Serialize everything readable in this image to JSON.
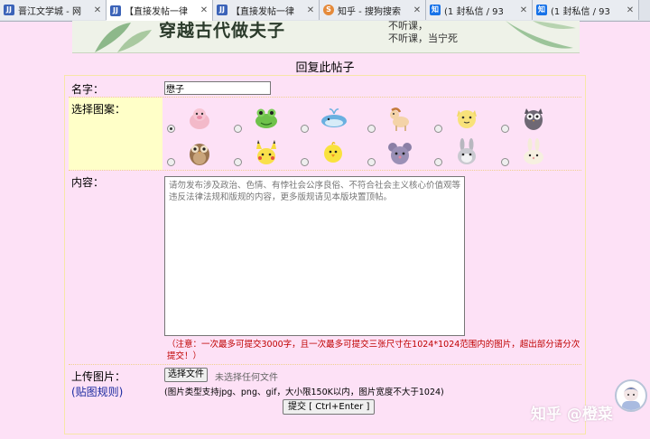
{
  "tabs": [
    {
      "icon": "jjwxc-favicon",
      "title": "晋江文学城 - 网",
      "active": false
    },
    {
      "icon": "jjwxc-favicon",
      "title": "【直接发帖一律",
      "active": true
    },
    {
      "icon": "jjwxc-favicon",
      "title": "【直接发帖一律",
      "active": false
    },
    {
      "icon": "sogou-favicon",
      "title": "知乎 - 搜狗搜索",
      "active": false
    },
    {
      "icon": "zhihu-favicon",
      "title": "(1 封私信 / 93",
      "active": false
    },
    {
      "icon": "zhihu-favicon",
      "title": "(1 封私信 / 93",
      "active": false
    }
  ],
  "banner": {
    "title": "穿越古代做夫子",
    "sub1": "不听课，",
    "sub2": "不听课，当宁死"
  },
  "page_title": "回复此帖子",
  "form": {
    "name_label": "名字：",
    "name_value": "懋子",
    "avatar_label": "选择图案：",
    "avatars": [
      {
        "icon": "pink-pig-icon",
        "selected": true
      },
      {
        "icon": "frog-icon",
        "selected": false
      },
      {
        "icon": "whale-icon",
        "selected": false
      },
      {
        "icon": "pony-icon",
        "selected": false
      },
      {
        "icon": "cat-icon",
        "selected": false
      },
      {
        "icon": "owl-dark-icon",
        "selected": false
      },
      {
        "icon": "owl-brown-icon",
        "selected": false
      },
      {
        "icon": "pikachu-icon",
        "selected": false
      },
      {
        "icon": "chick-icon",
        "selected": false
      },
      {
        "icon": "mouse-icon",
        "selected": false
      },
      {
        "icon": "grey-rabbit-icon",
        "selected": false
      },
      {
        "icon": "white-rabbit-icon",
        "selected": false
      }
    ],
    "content_label": "内容：",
    "content_placeholder": "请勿发布涉及政治、色情、有悖社会公序良俗、不符合社会主义核心价值观等违反法律法规和版规的内容，更多版规请见本版块置顶帖。",
    "content_note": "（注意：一次最多可提交3000字，且一次最多可提交三张尺寸在1024*1024范围内的图片，超出部分请分次提交！）",
    "upload_label": "上传图片：",
    "upload_rule_link": "(贴图规则)",
    "choose_file_button": "选择文件",
    "no_file_text": "未选择任何文件",
    "file_info": "(图片类型支持jpg、png、gif，大小限150K以内，图片宽度不大于1024)",
    "submit_button": "提交 [ Ctrl+Enter ]"
  },
  "watermark": "知乎 @橙菜"
}
